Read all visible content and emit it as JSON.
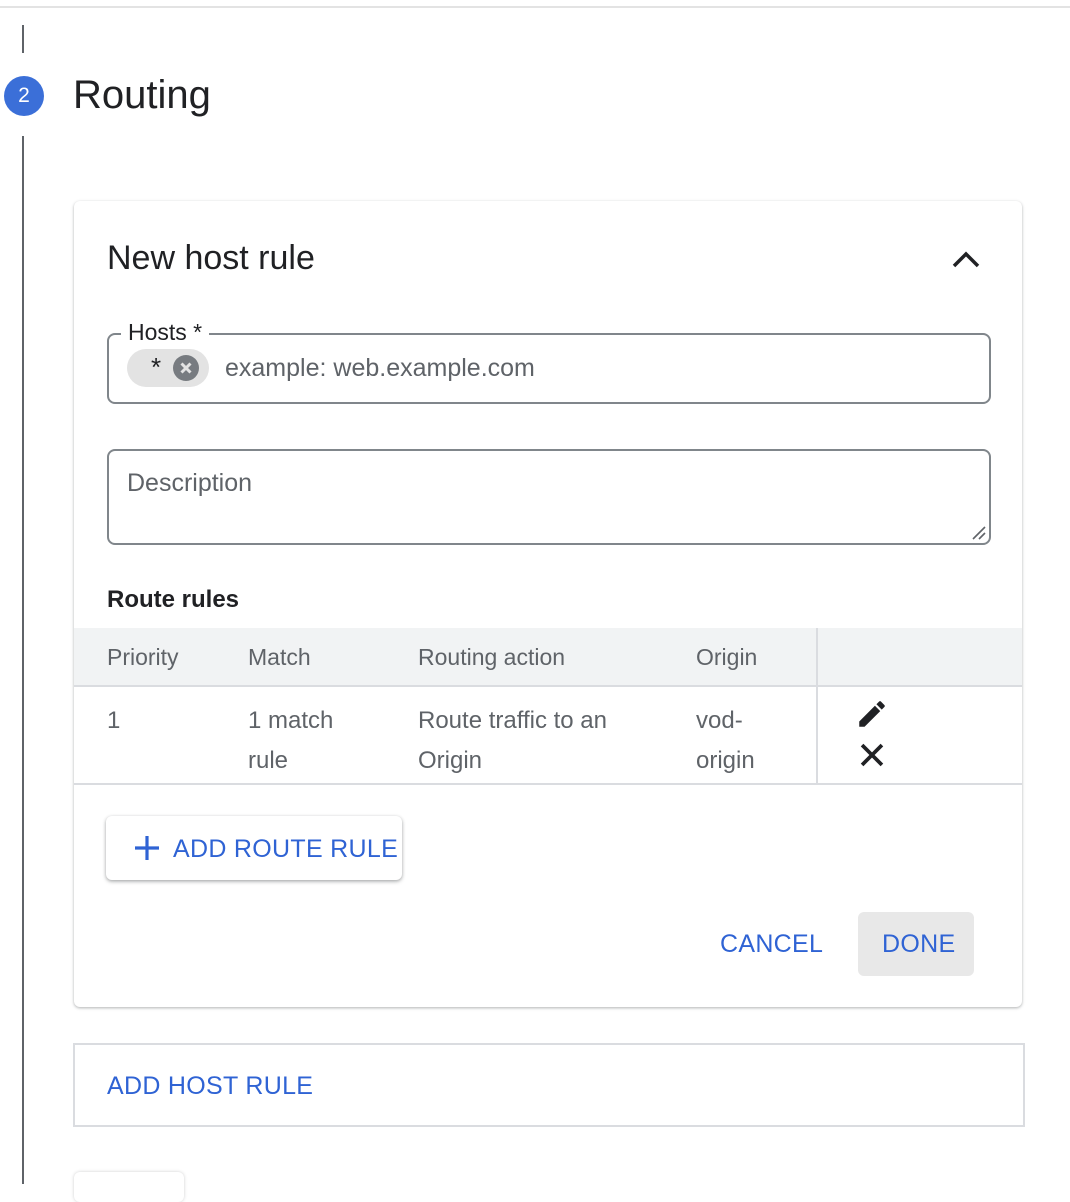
{
  "step": {
    "number": "2",
    "title": "Routing"
  },
  "host_rule": {
    "title": "New host rule",
    "collapse_icon": "chevron-up-icon",
    "hosts": {
      "label": "Hosts *",
      "chips": [
        {
          "text": "*",
          "remove_icon": "cancel-circle-icon"
        }
      ],
      "placeholder": "example: web.example.com"
    },
    "description": {
      "placeholder": "Description",
      "value": ""
    },
    "route_rules": {
      "title": "Route rules",
      "columns": [
        "Priority",
        "Match",
        "Routing action",
        "Origin"
      ],
      "rows": [
        {
          "priority": "1",
          "match": "1 match rule",
          "routing_action": "Route traffic to an Origin",
          "origin": "vod-origin",
          "edit_icon": "pencil-icon",
          "delete_icon": "close-icon"
        }
      ]
    },
    "add_route_rule_label": "ADD ROUTE RULE",
    "cancel_label": "CANCEL",
    "done_label": "DONE"
  },
  "add_host_rule_label": "ADD HOST RULE",
  "colors": {
    "accent": "#2f63d4",
    "step_badge": "#3b6fd8",
    "header_bg": "#f1f3f4"
  }
}
